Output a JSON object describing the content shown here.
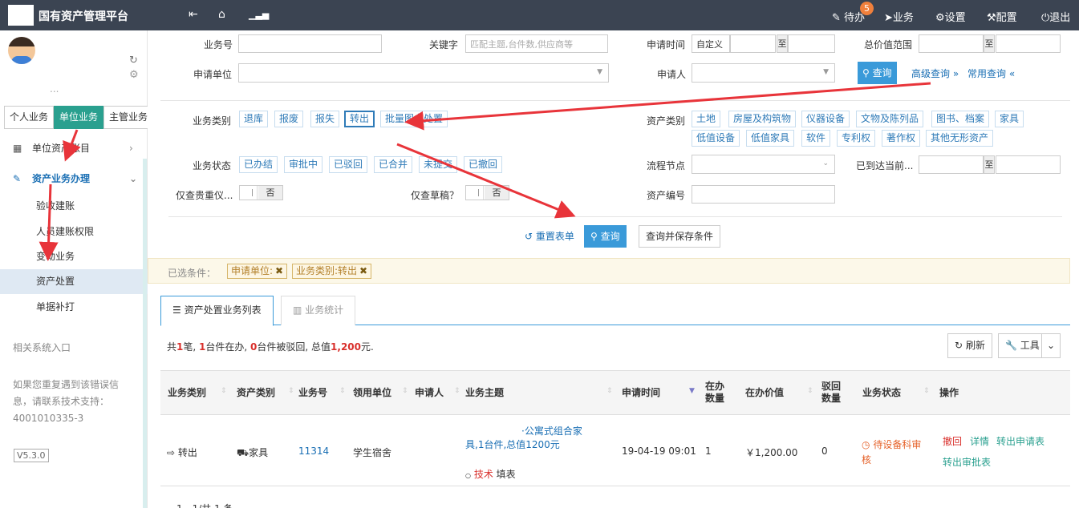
{
  "app": {
    "title": "国有资产管理平台",
    "menu": {
      "todo_label": "待办",
      "todo_count": "5",
      "business_label": "业务",
      "settings_label": "设置",
      "config_label": "配置",
      "logout_label": "退出"
    }
  },
  "sidebar": {
    "user_dots": "...",
    "tabs": [
      "个人业务",
      "单位业务",
      "主管业务"
    ],
    "active_tab": "单位业务",
    "nav": [
      {
        "label": "单位资产账目",
        "icon": "grid-icon"
      },
      {
        "label": "资产业务办理",
        "icon": "pencil-icon"
      }
    ],
    "subnav": [
      "验收建账",
      "人员建账权限",
      "变动业务",
      "资产处置",
      "单据补打"
    ],
    "active_sub": "资产处置",
    "related_label": "相关系统入口",
    "help_text_1": "如果您重复遇到该错误信",
    "help_text_2": "息，请联系技术支持：",
    "help_phone": "4001010335-3",
    "version": "V5.3.0"
  },
  "search": {
    "biz_no_label": "业务号",
    "keyword_label": "关键字",
    "keyword_placeholder": "匹配主题,台件数,供应商等",
    "apply_time_label": "申请时间",
    "date_preset": "自定义",
    "range_to": "至",
    "total_value_label": "总价值范围",
    "apply_unit_label": "申请单位",
    "applicant_label": "申请人",
    "query_label": "查询",
    "advanced_label": "高级查询",
    "common_label": "常用查询",
    "biz_type_label": "业务类别",
    "biz_types": [
      "退库",
      "报废",
      "报失",
      "转出",
      "批量图书处置"
    ],
    "asset_type_label": "资产类别",
    "asset_types_row1": [
      "土地",
      "房屋及构筑物",
      "仪器设备",
      "文物及陈列品",
      "图书、档案",
      "家具"
    ],
    "asset_types_row2": [
      "低值设备",
      "低值家具",
      "软件",
      "专利权",
      "著作权",
      "其他无形资产"
    ],
    "status_label": "业务状态",
    "statuses": [
      "已办结",
      "审批中",
      "已驳回",
      "已合并",
      "未提交",
      "已撤回"
    ],
    "flow_node_label": "流程节点",
    "reached_label": "已到达当前...",
    "valuable_label": "仅查贵重仪...",
    "draft_label": "仅查草稿？",
    "toggle_off": "否",
    "asset_no_label": "资产编号",
    "reset_label": "重置表单",
    "query_save_label": "查询并保存条件"
  },
  "conditions": {
    "label": "已选条件：",
    "chips": [
      "申请单位:",
      "业务类别:转出"
    ]
  },
  "tabs": {
    "list_label": "资产处置业务列表",
    "stats_label": "业务统计"
  },
  "summary": {
    "p1": "共",
    "count": "1",
    "p2": "笔,",
    "in_progress": "1",
    "p3": "台件在办,",
    "rejected": "0",
    "p4": "台件被驳回, 总值",
    "total": "1,200",
    "p5": "元."
  },
  "toolbar": {
    "refresh_label": "刷新",
    "tools_label": "工具"
  },
  "table": {
    "headers": {
      "biz_type": "业务类别",
      "asset_type": "资产类别",
      "biz_no": "业务号",
      "recv_unit": "领用单位",
      "applicant": "申请人",
      "subject": "业务主题",
      "apply_time": "申请时间",
      "qty_1": "在办",
      "qty_2": "数量",
      "value": "在办价值",
      "rej_1": "驳回",
      "rej_2": "数量",
      "status": "业务状态",
      "ops": "操作"
    },
    "row": {
      "biz_type": "转出",
      "asset_type": "家具",
      "biz_no": "11314",
      "recv_unit": "学生宿舍",
      "subject_1": "·公寓式组合家",
      "subject_2": "具,1台件,总值1200元",
      "sub_dept": "技术",
      "sub_action": "填表",
      "apply_time": "19-04-19 09:01",
      "qty": "1",
      "value": "￥1,200.00",
      "rejected": "0",
      "status_1": "待设备科审",
      "status_2": "核",
      "op_revoke": "撤回",
      "op_detail": "详情",
      "op_transfer_apply": "转出申请表",
      "op_transfer_approve": "转出审批表"
    }
  },
  "pager": "1 - 1/共 1 条",
  "colors": {
    "topbar": "#3b4452",
    "accent": "#2aa08f",
    "primary": "#3a9ad9",
    "danger": "#d9302c",
    "annotation_arrow": "#e8343a"
  }
}
